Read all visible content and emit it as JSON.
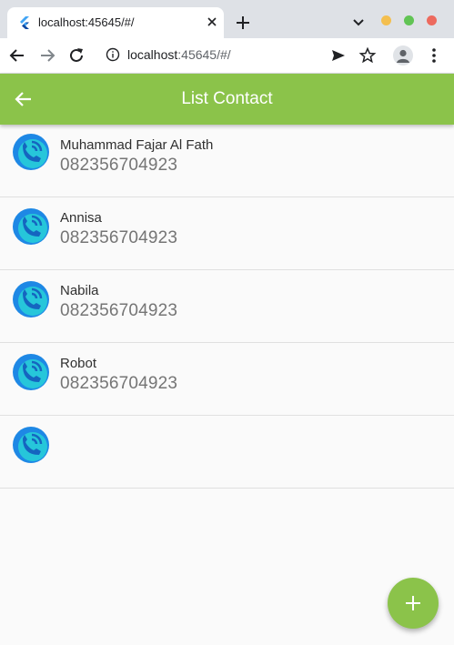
{
  "browser": {
    "tab_title": "localhost:45645/#/",
    "url_host": "localhost",
    "url_rest": ":45645/#/",
    "window_controls": {
      "minimize_color": "#f4bf4f",
      "maximize_color": "#61c454",
      "close_color": "#ed6a5e"
    }
  },
  "appbar": {
    "title": "List Contact",
    "color": "#8bc34a",
    "back_icon": "arrow-left-icon"
  },
  "contacts": [
    {
      "name": "Muhammad Fajar Al Fath",
      "phone": "082356704923"
    },
    {
      "name": "Annisa",
      "phone": "082356704923"
    },
    {
      "name": "Nabila",
      "phone": "082356704923"
    },
    {
      "name": "Robot",
      "phone": "082356704923"
    },
    {
      "name": "",
      "phone": ""
    }
  ],
  "fab": {
    "icon": "plus-icon"
  },
  "contact_icon": "phone-call-icon"
}
